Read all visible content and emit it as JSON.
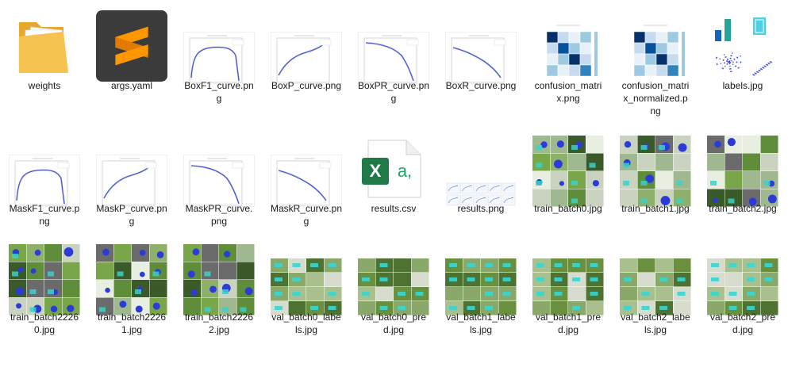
{
  "files": [
    {
      "name": "weights",
      "display": "weights",
      "type": "folder"
    },
    {
      "name": "args.yaml",
      "display": "args.yaml",
      "type": "yaml"
    },
    {
      "name": "BoxF1_curve.png",
      "display": "BoxF1_curve.pn\ng",
      "type": "curve"
    },
    {
      "name": "BoxP_curve.png",
      "display": "BoxP_curve.png",
      "type": "curve"
    },
    {
      "name": "BoxPR_curve.png",
      "display": "BoxPR_curve.pn\ng",
      "type": "curve"
    },
    {
      "name": "BoxR_curve.png",
      "display": "BoxR_curve.png",
      "type": "curve"
    },
    {
      "name": "confusion_matrix.png",
      "display": "confusion_matri\nx.png",
      "type": "matrix"
    },
    {
      "name": "confusion_matrix_normalized.png",
      "display": "confusion_matri\nx_normalized.p\nng",
      "type": "matrix"
    },
    {
      "name": "labels.jpg",
      "display": "labels.jpg",
      "type": "labels"
    },
    {
      "name": "MaskF1_curve.png",
      "display": "MaskF1_curve.p\nng",
      "type": "curve"
    },
    {
      "name": "MaskP_curve.png",
      "display": "MaskP_curve.pn\ng",
      "type": "curve"
    },
    {
      "name": "MaskPR_curve.png",
      "display": "MaskPR_curve.\npng",
      "type": "curve"
    },
    {
      "name": "MaskR_curve.png",
      "display": "MaskR_curve.pn\ng",
      "type": "curve"
    },
    {
      "name": "results.csv",
      "display": "results.csv",
      "type": "csv"
    },
    {
      "name": "results.png",
      "display": "results.png",
      "type": "results"
    },
    {
      "name": "train_batch0.jpg",
      "display": "train_batch0.jpg",
      "type": "mosaic"
    },
    {
      "name": "train_batch1.jpg",
      "display": "train_batch1.jpg",
      "type": "mosaic"
    },
    {
      "name": "train_batch2.jpg",
      "display": "train_batch2.jpg",
      "type": "mosaic"
    },
    {
      "name": "train_batch22260.jpg",
      "display": "train_batch2226\n0.jpg",
      "type": "mosaic"
    },
    {
      "name": "train_batch22261.jpg",
      "display": "train_batch2226\n1.jpg",
      "type": "mosaic"
    },
    {
      "name": "train_batch22262.jpg",
      "display": "train_batch2226\n2.jpg",
      "type": "mosaic"
    },
    {
      "name": "val_batch0_labels.jpg",
      "display": "val_batch0_labe\nls.jpg",
      "type": "val"
    },
    {
      "name": "val_batch0_pred.jpg",
      "display": "val_batch0_pre\nd.jpg",
      "type": "val"
    },
    {
      "name": "val_batch1_labels.jpg",
      "display": "val_batch1_labe\nls.jpg",
      "type": "val"
    },
    {
      "name": "val_batch1_pred.jpg",
      "display": "val_batch1_pre\nd.jpg",
      "type": "val"
    },
    {
      "name": "val_batch2_labels.jpg",
      "display": "val_batch2_labe\nls.jpg",
      "type": "val"
    },
    {
      "name": "val_batch2_pred.jpg",
      "display": "val_batch2_pre\nd.jpg",
      "type": "val"
    }
  ],
  "excel_glyph": "X",
  "excel_suffix": "a,",
  "colors": {
    "folder": "#f6c350",
    "sublime_bg": "#3b3b3b",
    "sublime_accent": "#ff9800",
    "excel_green": "#1f7a47",
    "curve_blue": "#3b4fd1"
  }
}
